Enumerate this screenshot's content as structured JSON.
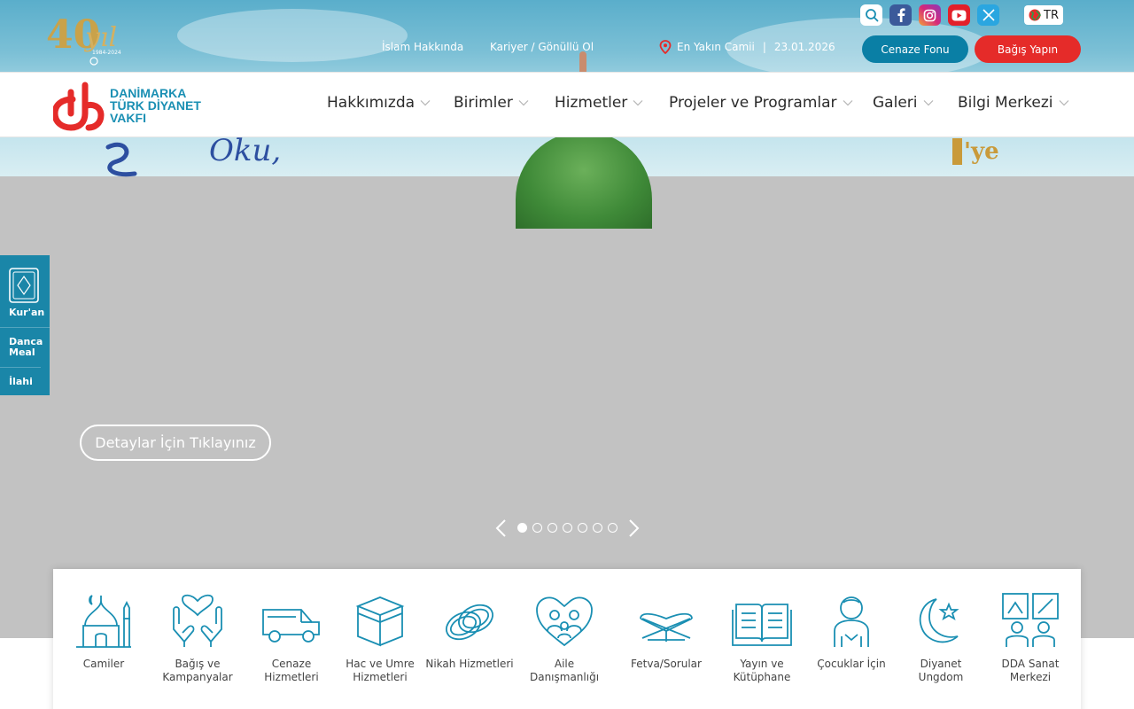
{
  "header": {
    "anniversary_logo": {
      "number": "40",
      "word": "yıl",
      "years": "1984-2024"
    },
    "util_links": [
      "İslam Hakkında",
      "Kariyer / Gönüllü Ol"
    ],
    "nearest_mosque": "En Yakın Camii",
    "date": "23.01.2026",
    "language": "TR",
    "buttons": {
      "funeral_fund": "Cenaze Fonu",
      "donate": "Bağış Yapın"
    },
    "social_icons": [
      "search-icon",
      "facebook-icon",
      "instagram-icon",
      "youtube-icon",
      "x-icon"
    ],
    "colors": {
      "funeral_fund": "#0a7fa5",
      "donate": "#e52b29",
      "brand": "#1a8fb3",
      "brand_red": "#e52b29"
    }
  },
  "brand": {
    "line1": "DANİMARKA",
    "line2": "TÜRK DİYANET",
    "line3": "VAKFI"
  },
  "nav": [
    "Hakkımızda",
    "Birimler",
    "Hizmetler",
    "Projeler ve Programlar",
    "Galeri",
    "Bilgi Merkezi"
  ],
  "side_tabs": {
    "quran": "Kur'an",
    "danish_meal": "Danca Meal",
    "hymns": "İlahi"
  },
  "hero": {
    "details_button": "Detaylar İçin Tıklayınız",
    "slide_count": 7,
    "active_slide": 1,
    "background_text": {
      "left": "Oku,",
      "right": "'ye"
    }
  },
  "services": [
    {
      "label": "Camiler",
      "icon": "mosque-icon"
    },
    {
      "label": "Bağış ve Kampanyalar",
      "icon": "donation-hands-icon"
    },
    {
      "label": "Cenaze Hizmetleri",
      "icon": "funeral-van-icon"
    },
    {
      "label": "Hac ve Umre Hizmetleri",
      "icon": "kaaba-icon"
    },
    {
      "label": "Nikah Hizmetleri",
      "icon": "rings-icon"
    },
    {
      "label": "Aile Danışmanlığı",
      "icon": "family-heart-icon"
    },
    {
      "label": "Fetva/Sorular",
      "icon": "open-quran-icon"
    },
    {
      "label": "Yayın ve Kütüphane",
      "icon": "book-icon"
    },
    {
      "label": "Çocuklar İçin",
      "icon": "child-icon"
    },
    {
      "label": "Diyanet Ungdom",
      "icon": "crescent-star-icon"
    },
    {
      "label": "DDA Sanat Merkezi",
      "icon": "art-center-icon"
    }
  ]
}
